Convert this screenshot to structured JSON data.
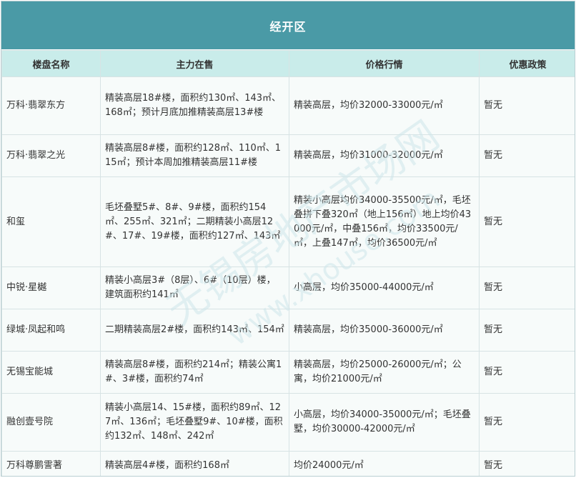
{
  "title": "经开区",
  "columns": [
    "楼盘名称",
    "主力在售",
    "价格行情",
    "优惠政策"
  ],
  "rows": [
    {
      "name": "万科·翡翠东方",
      "sale": "精装高层18#楼，面积约130㎡、143㎡、168㎡；预计月底加推精装高层13#楼",
      "price": "精装高层，均价32000-33000元/㎡",
      "policy": "暂无"
    },
    {
      "name": "万科·翡翠之光",
      "sale": "精装高层8#楼，面积约128㎡、110㎡、115㎡；预计本周加推精装高层11#楼",
      "price": "精装高层，均价31000-32000元/㎡",
      "policy": "暂无"
    },
    {
      "name": "和玺",
      "sale": "毛坯叠墅5#、8#、9#楼，面积约154㎡、255㎡、321㎡；二期精装小高层12#、17#、19#楼，面积约127㎡、143㎡",
      "price": "精装小高层均价34000-35500元/㎡，毛坯叠拼下叠320㎡（地上156㎡）地上均价43000元/㎡，中叠156㎡，均价33500元/㎡，上叠147㎡，均价36500元/㎡",
      "policy": "暂无"
    },
    {
      "name": "中锐·星樾",
      "sale": "精装小高层3#（8层）、6#（10层）楼，建筑面积约141㎡",
      "price": "小高层，均价35000-44000元/㎡",
      "policy": "暂无"
    },
    {
      "name": "绿城·凤起和鸣",
      "sale": "二期精装高层2#楼，面积约143㎡、154㎡",
      "price": "精装高层，均价35000-36000元/㎡",
      "policy": "暂无"
    },
    {
      "name": "无锡宝能城",
      "sale": "精装高层8#楼，面积约214㎡；精装公寓1#、3#楼，面积约74㎡",
      "price": "精装高层，均价25000-26000元/㎡；公寓，均价21000元/㎡",
      "policy": "暂无"
    },
    {
      "name": "融创壹号院",
      "sale": "精装小高层14、15#楼，面积约89㎡、127㎡、136㎡；毛坯叠墅9#、10#楼，面积约132㎡、148㎡、242㎡",
      "price": "小高层，均价34000-35000元/㎡；毛坯叠墅，均价30000-42000元/㎡",
      "policy": "暂无"
    },
    {
      "name": "万科尊鹏霅著",
      "sale": "精装高层4#楼，面积约168㎡",
      "price": "均价24000元/㎡",
      "policy": "暂无"
    }
  ],
  "watermark": {
    "text": "无锡房地产市场网",
    "url_text": "www.xhouse.com",
    "color": "#cfe6ea"
  }
}
